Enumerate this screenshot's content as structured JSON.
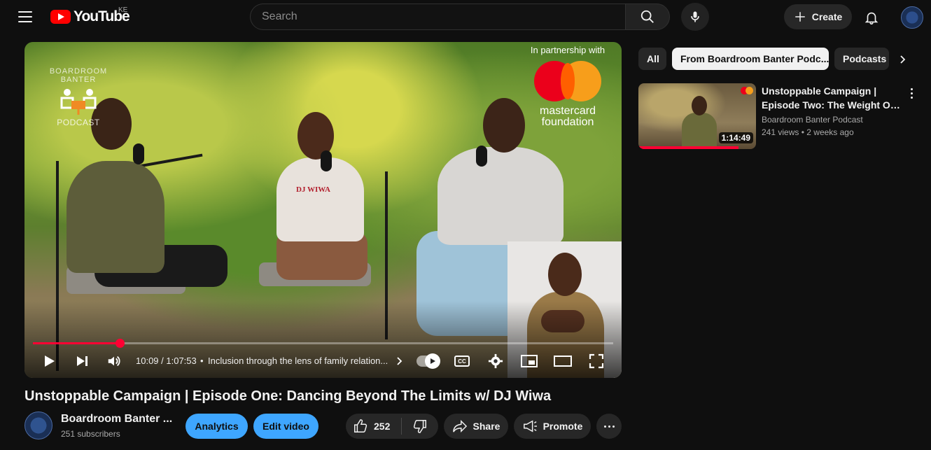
{
  "masthead": {
    "logo_text": "YouTube",
    "country_code": "KE",
    "search_placeholder": "Search",
    "create_label": "Create"
  },
  "player": {
    "podcast_logo_top": "BOARDROOM BANTER",
    "podcast_logo_bottom": "PODCAST",
    "partner_line": "In partnership with",
    "partner_brand_line1": "mastercard",
    "partner_brand_line2": "foundation",
    "shirt_text": "DJ WIWA",
    "time_display": "10:09 / 1:07:53",
    "chapter_title": "Inclusion through the lens of family relation...",
    "progress_fraction": 0.149
  },
  "video": {
    "title": "Unstoppable Campaign | Episode One: Dancing Beyond The Limits w/ DJ Wiwa",
    "channel_name": "Boardroom Banter ...",
    "subscribers": "251 subscribers",
    "analytics_label": "Analytics",
    "edit_label": "Edit video",
    "like_count": "252",
    "share_label": "Share",
    "promote_label": "Promote"
  },
  "chips": [
    {
      "label": "All",
      "active": false
    },
    {
      "label": "From Boardroom Banter Podc...",
      "active": true
    },
    {
      "label": "Podcasts",
      "active": false
    }
  ],
  "recommendations": [
    {
      "title_line1": "Unstoppable Campaign |",
      "title_line2": "Episode Two: The Weight Of...",
      "channel": "Boardroom Banter Podcast",
      "views": "241 views",
      "age": "2 weeks ago",
      "duration": "1:14:49",
      "watched_fraction": 0.85
    }
  ],
  "colors": {
    "accent_red": "#ff0033",
    "blue_button": "#3ea6ff",
    "mastercard_red": "#eb001b",
    "mastercard_orange": "#f79e1b"
  },
  "icons": [
    "menu-icon",
    "youtube-logo-icon",
    "search-icon",
    "mic-icon",
    "plus-icon",
    "bell-icon",
    "play-icon",
    "next-icon",
    "volume-icon",
    "chevron-right-icon",
    "autoplay-icon",
    "cc-icon",
    "settings-icon",
    "miniplayer-icon",
    "theater-icon",
    "fullscreen-icon",
    "thumbs-up-icon",
    "thumbs-down-icon",
    "share-icon",
    "promote-icon",
    "more-icon"
  ]
}
